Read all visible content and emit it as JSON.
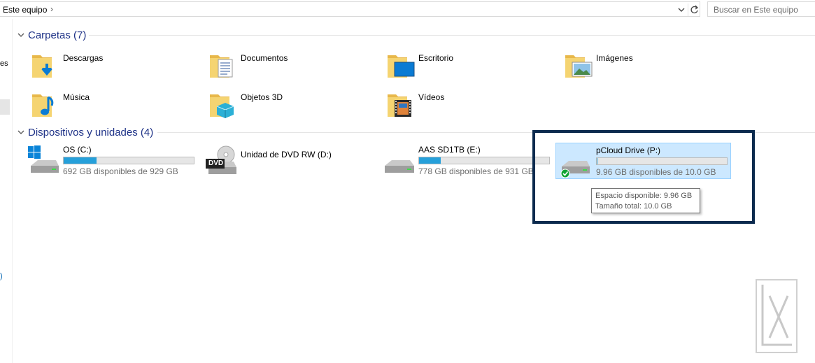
{
  "address_bar": {
    "path": "Este equipo",
    "search_placeholder": "Buscar en Este equipo"
  },
  "nav_pane": {
    "partial_text": "es"
  },
  "folders_group": {
    "title": "Carpetas (7)",
    "items": [
      {
        "label": "Descargas",
        "icon": "downloads-folder-icon"
      },
      {
        "label": "Documentos",
        "icon": "documents-folder-icon"
      },
      {
        "label": "Escritorio",
        "icon": "desktop-folder-icon"
      },
      {
        "label": "Imágenes",
        "icon": "pictures-folder-icon"
      },
      {
        "label": "Música",
        "icon": "music-folder-icon"
      },
      {
        "label": "Objetos 3D",
        "icon": "3d-objects-folder-icon"
      },
      {
        "label": "Vídeos",
        "icon": "videos-folder-icon"
      }
    ]
  },
  "devices_group": {
    "title": "Dispositivos y unidades (4)",
    "items": [
      {
        "label": "OS (C:)",
        "free": "692 GB disponibles de 929 GB",
        "used_fraction": 0.255,
        "icon": "windows-drive-icon"
      },
      {
        "label": "Unidad de DVD RW (D:)",
        "icon": "dvd-drive-icon"
      },
      {
        "label": "AAS SD1TB (E:)",
        "free": "778 GB disponibles de 931 GB",
        "used_fraction": 0.164,
        "icon": "hard-drive-icon"
      },
      {
        "label": "pCloud Drive (P:)",
        "free": "9.96 GB disponibles de 10.0 GB",
        "used_fraction": 0.004,
        "icon": "pcloud-drive-icon",
        "selected": true
      }
    ]
  },
  "tooltip": {
    "line1": "Espacio disponible: 9.96 GB",
    "line2": "Tamaño total: 10.0 GB"
  },
  "colors": {
    "accent_blue": "#26a0da",
    "group_title": "#1e3287",
    "selection": "#cce8ff",
    "highlight_frame": "#0b2a4e"
  }
}
